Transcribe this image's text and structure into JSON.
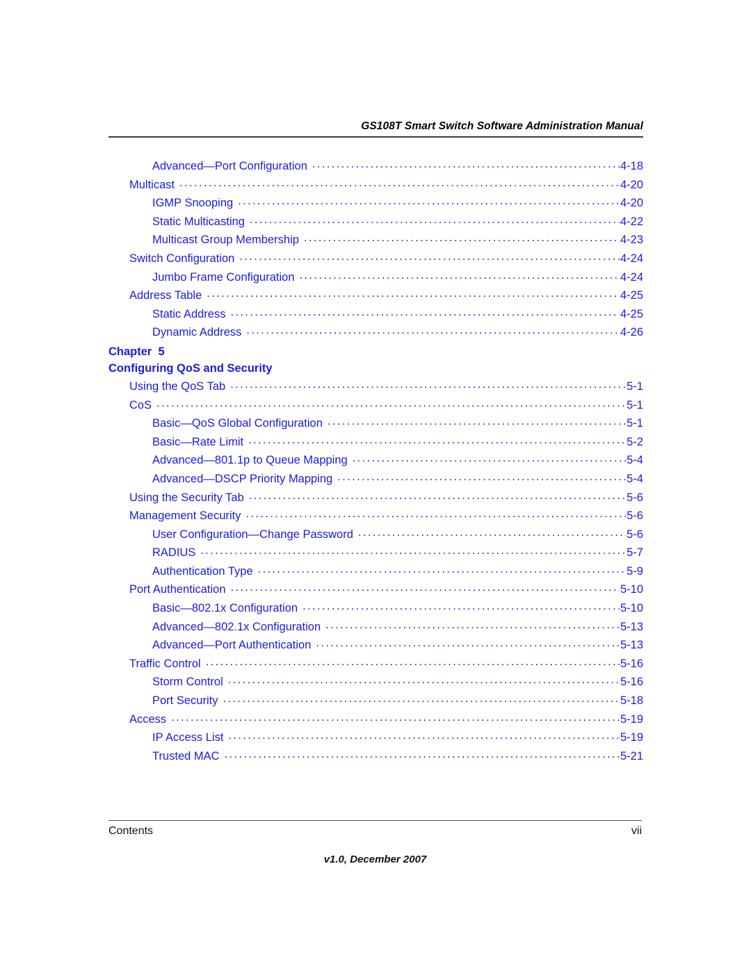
{
  "header": {
    "title": "GS108T Smart Switch Software Administration Manual"
  },
  "toc": {
    "entries": [
      {
        "level": 2,
        "title": "Advanced—Port Configuration",
        "page": "4-18"
      },
      {
        "level": 1,
        "title": "Multicast",
        "page": "4-20"
      },
      {
        "level": 2,
        "title": "IGMP Snooping",
        "page": "4-20"
      },
      {
        "level": 2,
        "title": "Static Multicasting",
        "page": "4-22"
      },
      {
        "level": 2,
        "title": "Multicast Group Membership",
        "page": "4-23"
      },
      {
        "level": 1,
        "title": "Switch Configuration",
        "page": "4-24"
      },
      {
        "level": 2,
        "title": "Jumbo Frame Configuration",
        "page": "4-24"
      },
      {
        "level": 1,
        "title": "Address Table",
        "page": "4-25"
      },
      {
        "level": 2,
        "title": "Static Address",
        "page": "4-25"
      },
      {
        "level": 2,
        "title": "Dynamic Address",
        "page": "4-26"
      }
    ],
    "chapter": {
      "label": "Chapter",
      "number": "5",
      "title": "Configuring QoS and Security"
    },
    "entries2": [
      {
        "level": 1,
        "title": "Using the QoS Tab",
        "page": "5-1"
      },
      {
        "level": 1,
        "title": "CoS",
        "page": "5-1"
      },
      {
        "level": 2,
        "title": "Basic—QoS Global Configuration",
        "page": "5-1"
      },
      {
        "level": 2,
        "title": "Basic—Rate Limit",
        "page": "5-2"
      },
      {
        "level": 2,
        "title": "Advanced—801.1p to Queue Mapping",
        "page": "5-4"
      },
      {
        "level": 2,
        "title": "Advanced—DSCP Priority Mapping",
        "page": "5-4"
      },
      {
        "level": 1,
        "title": "Using the Security Tab",
        "page": "5-6"
      },
      {
        "level": 1,
        "title": "Management Security",
        "page": "5-6"
      },
      {
        "level": 2,
        "title": "User Configuration—Change Password",
        "page": "5-6"
      },
      {
        "level": 2,
        "title": "RADIUS",
        "page": "5-7"
      },
      {
        "level": 2,
        "title": "Authentication Type",
        "page": "5-9"
      },
      {
        "level": 1,
        "title": "Port Authentication",
        "page": "5-10"
      },
      {
        "level": 2,
        "title": "Basic—802.1x Configuration",
        "page": "5-10"
      },
      {
        "level": 2,
        "title": "Advanced—802.1x Configuration",
        "page": "5-13"
      },
      {
        "level": 2,
        "title": "Advanced—Port Authentication",
        "page": "5-13"
      },
      {
        "level": 1,
        "title": "Traffic Control",
        "page": "5-16"
      },
      {
        "level": 2,
        "title": "Storm Control",
        "page": "5-16"
      },
      {
        "level": 2,
        "title": "Port Security",
        "page": "5-18"
      },
      {
        "level": 1,
        "title": "Access",
        "page": "5-19"
      },
      {
        "level": 2,
        "title": "IP Access List",
        "page": "5-19"
      },
      {
        "level": 2,
        "title": "Trusted MAC",
        "page": "5-21"
      }
    ]
  },
  "footer": {
    "left": "Contents",
    "right": "vii",
    "version": "v1.0, December 2007"
  },
  "colors": {
    "link_blue": "#1a1ae0",
    "rule_dark": "#3a3a3a",
    "text_black": "#111111"
  }
}
